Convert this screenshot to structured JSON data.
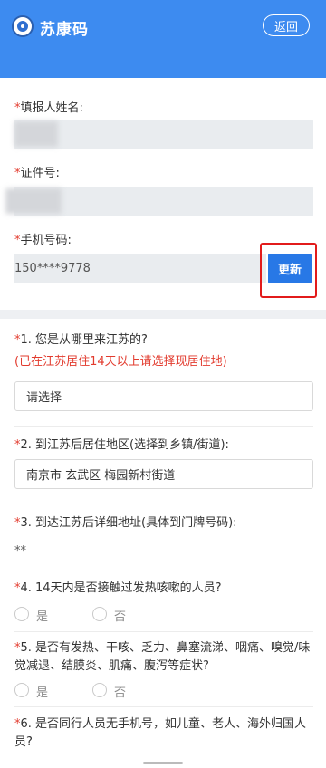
{
  "header": {
    "title": "苏康码",
    "back_label": "返回",
    "colors": {
      "header_bg": "#3d8bf0",
      "accent": "#2878e6",
      "required": "#e23b2e"
    }
  },
  "form": {
    "name_label": "填报人姓名:",
    "id_label": "证件号:",
    "phone_label": "手机号码:",
    "phone_value": "150****9778",
    "update_label": "更新",
    "required_mark": "*"
  },
  "questions": [
    {
      "text": "1. 您是从哪里来江苏的?",
      "hint": "(已在江苏居住14天以上请选择现居住地)",
      "value": "请选择"
    },
    {
      "text": "2. 到江苏后居住地区(选择到乡镇/街道):",
      "value": "南京市 玄武区 梅园新村街道"
    },
    {
      "text": "3. 到达江苏后详细地址(具体到门牌号码):",
      "value": "**"
    },
    {
      "text": "4. 14天内是否接触过发热咳嗽的人员?",
      "options": [
        "是",
        "否"
      ]
    },
    {
      "text": "5. 是否有发热、干咳、乏力、鼻塞流涕、咽痛、嗅觉/味觉减退、结膜炎、肌痛、腹泻等症状?",
      "options": [
        "是",
        "否"
      ]
    },
    {
      "text": "6. 是否同行人员无手机号，如儿童、老人、海外归国人员?"
    }
  ],
  "icons": [
    "app-logo-icon",
    "radio-icon"
  ]
}
